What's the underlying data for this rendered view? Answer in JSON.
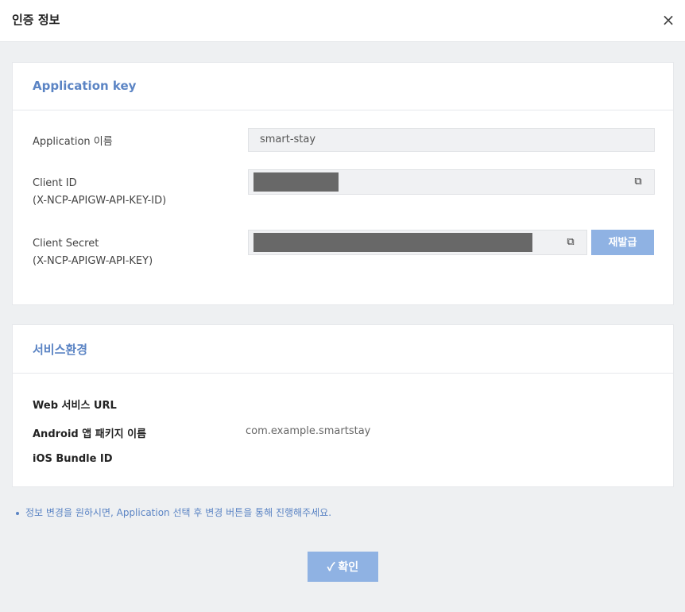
{
  "dialog": {
    "title": "인증 정보",
    "close_glyph": "×"
  },
  "app_key": {
    "section_title": "Application key",
    "app_name_label": "Application 이름",
    "app_name_value": "smart-stay",
    "client_id_label_1": "Client ID",
    "client_id_label_2": "(X-NCP-APIGW-API-KEY-ID)",
    "client_secret_label_1": "Client Secret",
    "client_secret_label_2": "(X-NCP-APIGW-API-KEY)",
    "copy_icon": "copy-icon",
    "copy_glyph": "⧉",
    "reissue_label": "재발급"
  },
  "service": {
    "section_title": "서비스환경",
    "web_label": "Web 서비스 URL",
    "web_value": "",
    "android_label": "Android 앱 패키지 이름",
    "android_value": "com.example.smartstay",
    "ios_label": "iOS Bundle ID",
    "ios_value": ""
  },
  "note": "정보 변경을 원하시면, Application 선택 후 변경 버튼을 통해 진행해주세요.",
  "confirm": {
    "check_glyph": "✓",
    "label": "확인"
  },
  "colors": {
    "accent": "#5b84c4",
    "button": "#8fb2e3",
    "mask": "#686868"
  }
}
